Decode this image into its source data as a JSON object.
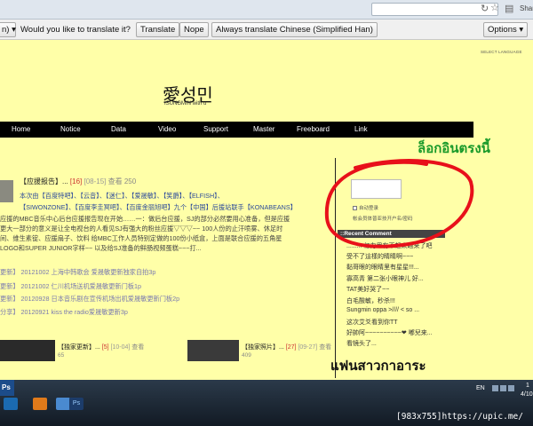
{
  "browser": {
    "share_label": "Shar",
    "bookmark_icon": "star-icon",
    "menu_icon": "wrench-icon"
  },
  "translate_bar": {
    "language_partial": "n)",
    "question": "Would you like to translate it?",
    "translate_label": "Translate",
    "nope_label": "Nope",
    "always_label": "Always translate Chinese (Simplified Han)",
    "options_label": "Options"
  },
  "site": {
    "lang_select": "SELECT LANGUAGE",
    "title": "愛성민",
    "subtitle": "ISUNGMIN with u",
    "nav": [
      "Home",
      "Notice",
      "Data",
      "Video",
      "Support",
      "Master",
      "Freeboard",
      "Link"
    ]
  },
  "post1": {
    "title": "【应援报告】",
    "dots": "...",
    "num": "[16]",
    "date": "[08-15]",
    "views": "查看 250",
    "lines": [
      "本次由【百度特吧】、【云音】、【迷仁】、【爱晟敏】、【笑爵】、【ELFISH】、",
      "【SIWONZONE】、【百度李圭冥吧】、【百度金丽旭吧】九个【中国】后援站联手【KONABEANS】",
      "应援的MBC音乐中心后台应援报告现在开始……一：做后台应援，SJ的部分必然要用心准备，但是应援",
      "更大一部分的意义是让全电视台的人看见SJ有强大的粉丝应援▽▽▽~~ 100人份的止汗喷雾、休足时",
      "间、维生素锭、应援扇子、饮料 给MBC工作人员特别定做的100份小纸盒，上面是联合应援的五角星",
      "LOGO和SUPER JUNIOR字样~~ 以及给SJ准备的鲜肠视频蛋糕~~~打..."
    ]
  },
  "related": [
    "更新】 20121002 上海中韩歌会 爱晟敏更新独家自拍3p",
    "更新】 20121002 仁川机场送机爱晟敏更新门板1p",
    "更新】 20120928 日本音乐剧在宣传机场出机爱晟敏更新门板2p",
    "分享】 20120921 kiss the radio爱晟敏更新3p"
  ],
  "post2": {
    "title": "【独家更新】",
    "dots": "...",
    "num": "[5]",
    "date": "[10-04]",
    "views": "查看",
    "views_num": "65"
  },
  "post3": {
    "title": "【独家照片】",
    "dots": "...",
    "num": "[27]",
    "date": "[09-27]",
    "views": "查看",
    "views_num": "409"
  },
  "sidebar": {
    "remember_label": "自动登录",
    "login_links": "帐会员体普亚技开户名/密码",
    "recent_header": "::Recent Comment",
    "comments": [
      "......... 亿力里有不起来越来了吧",
      "受不了這樣的睛睛啊~~~",
      "黏哥眼的眼睛里有星星!!!...",
      "寡高青 第二张小眼神儿 好...",
      "TAT美好哭了~~",
      "白毛酸敏，秒杀!!!",
      "Sungmin oppa >//// < so ...",
      "这次艾爻看到你TT",
      "好帥阿~~~~~~~~~~❤ 嘟兒来...",
      "看镜头了..."
    ]
  },
  "annotations": {
    "top_thai": "ล็อกอินตรงนี้",
    "bottom_thai": "แฟนสาวกาอาระ",
    "circle_color": "#e8101a"
  },
  "taskbar": {
    "start_label": "Ps",
    "lang": "EN",
    "clock_line1": "1",
    "clock_line2": "4/10",
    "ps_label": "Ps"
  },
  "credit": "[983x755]https://upic.me/"
}
